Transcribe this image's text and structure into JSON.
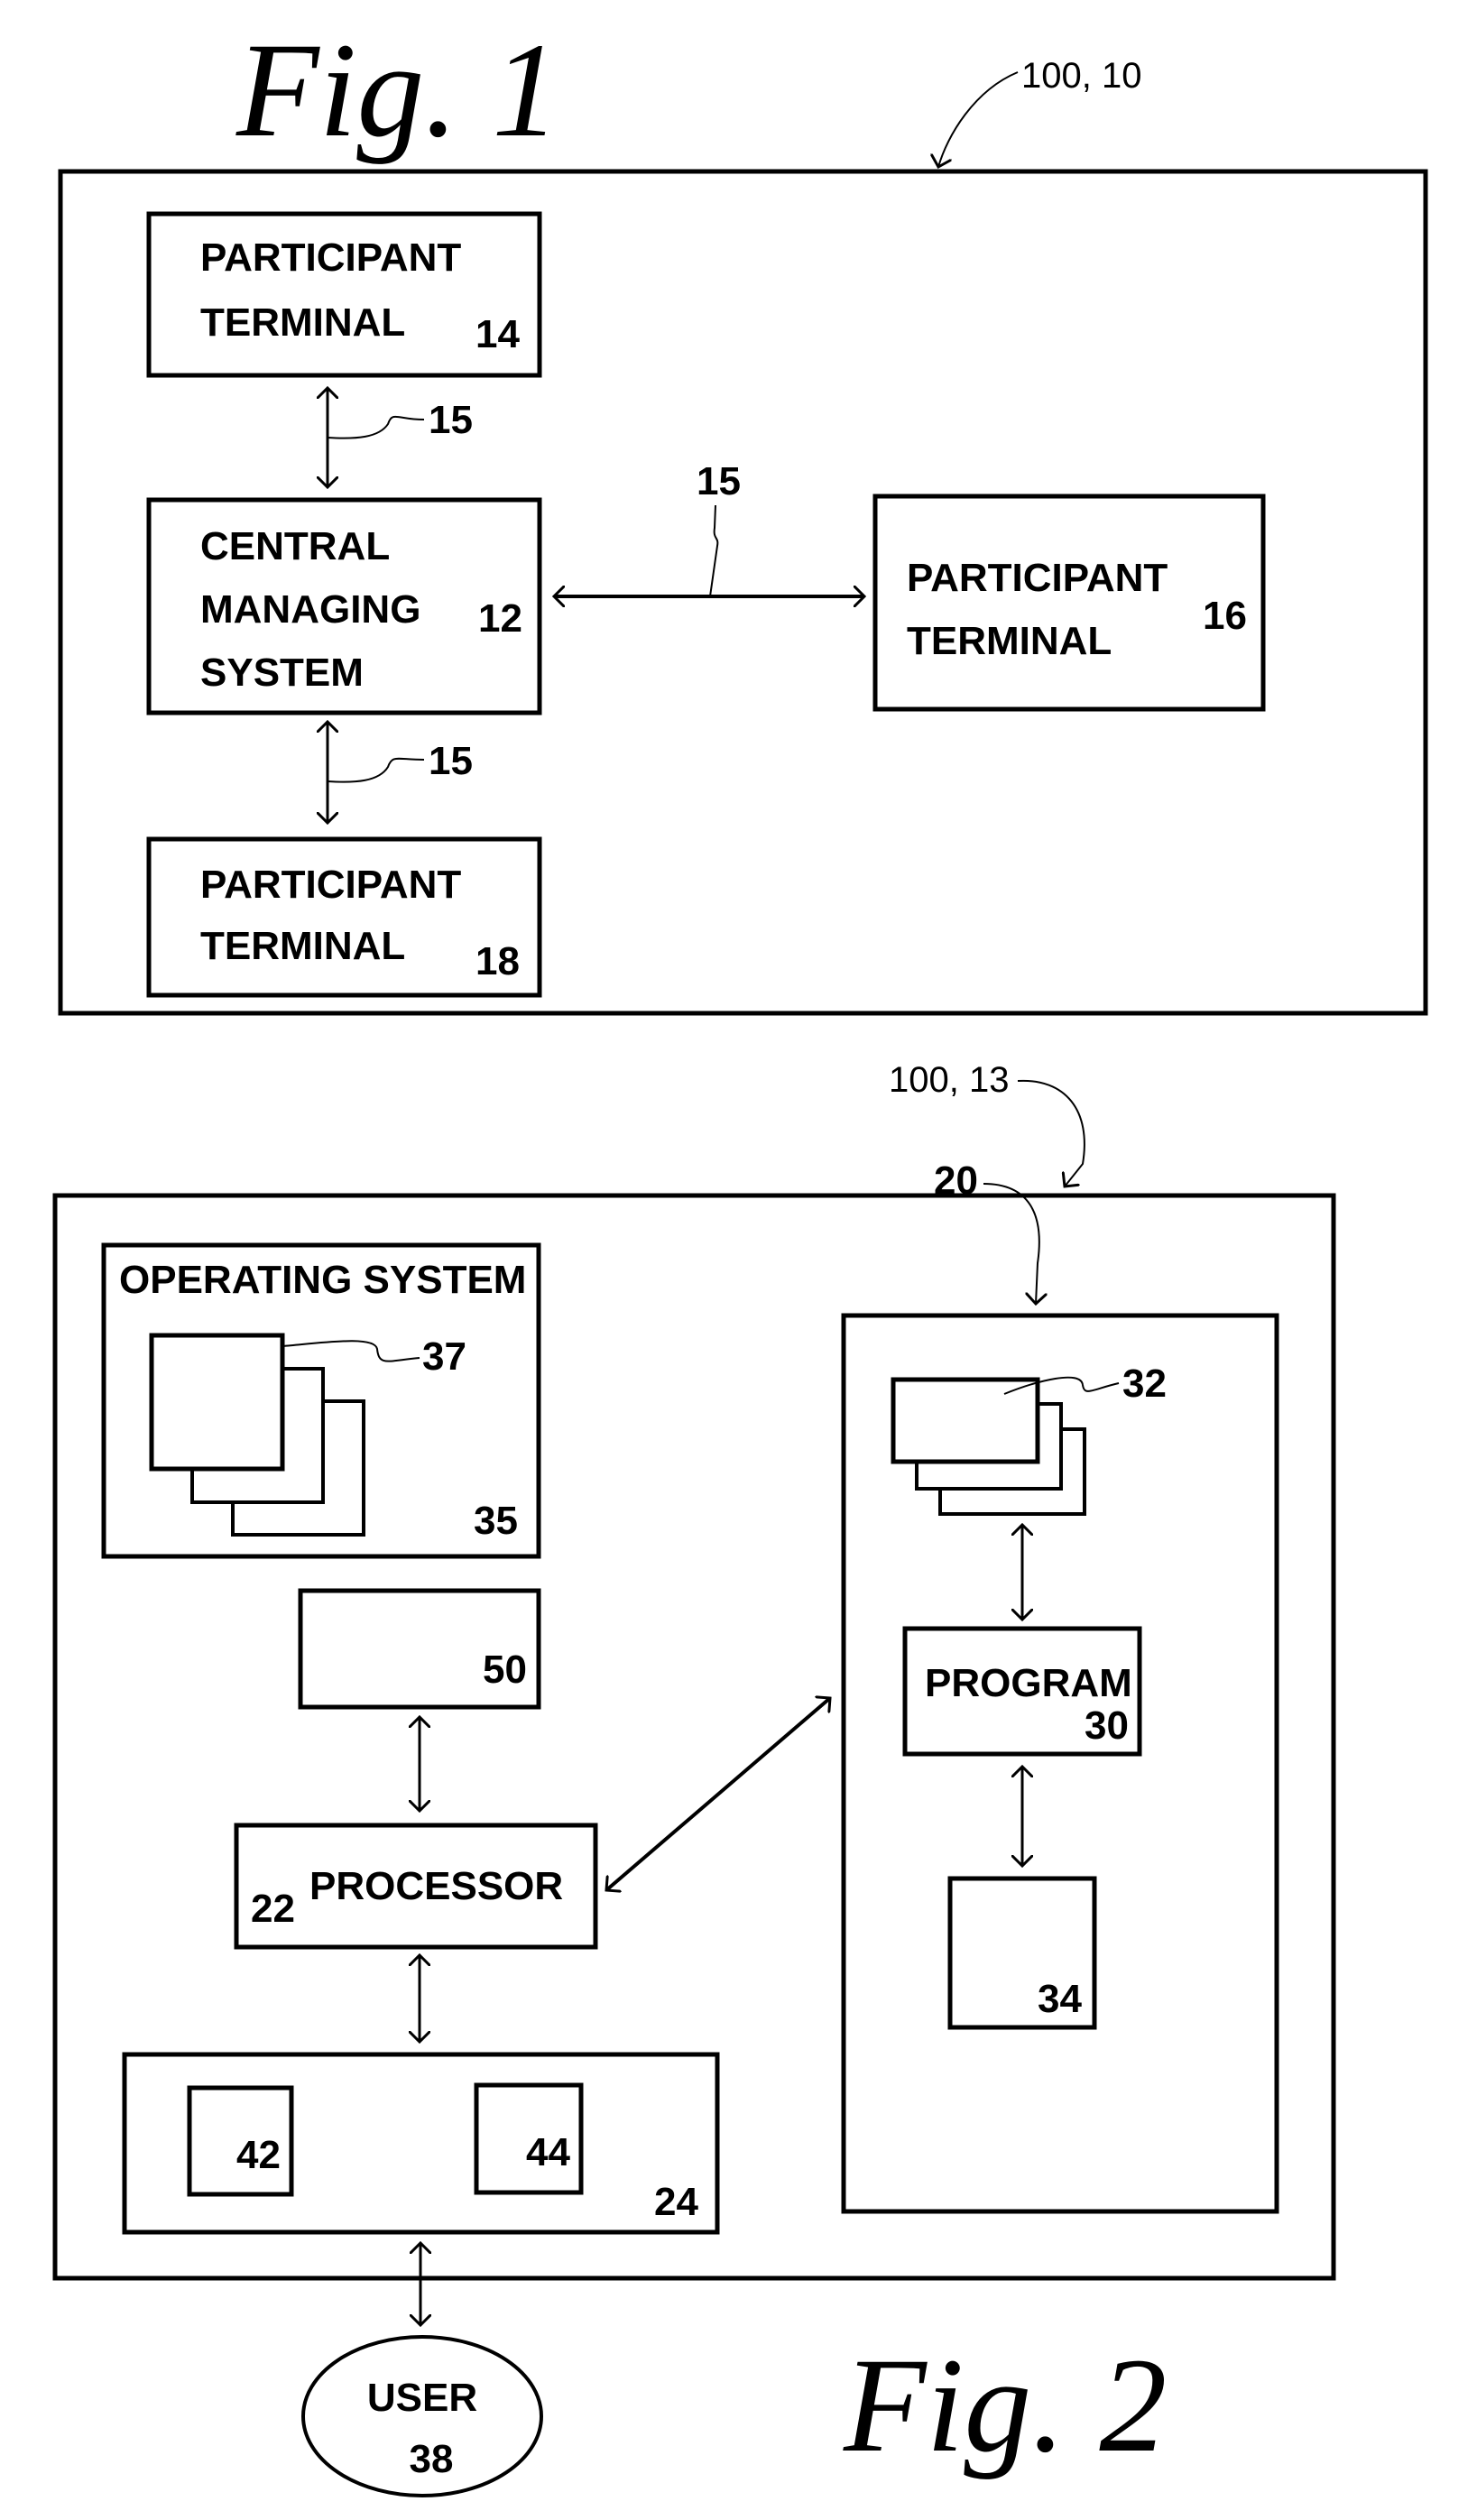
{
  "figure1": {
    "title": "Fig. 1",
    "ref_label": "100, 10",
    "connection_label": "15",
    "nodes": {
      "terminal_14": {
        "line1": "PARTICIPANT",
        "line2": "TERMINAL",
        "number": "14"
      },
      "central_12": {
        "line1": "CENTRAL",
        "line2": "MANAGING",
        "line3": "SYSTEM",
        "number": "12"
      },
      "terminal_16": {
        "line1": "PARTICIPANT",
        "line2": "TERMINAL",
        "number": "16"
      },
      "terminal_18": {
        "line1": "PARTICIPANT",
        "line2": "TERMINAL",
        "number": "18"
      }
    },
    "edges": [
      {
        "from": "14",
        "to": "12",
        "label": "15"
      },
      {
        "from": "12",
        "to": "16",
        "label": "15"
      },
      {
        "from": "12",
        "to": "18",
        "label": "15"
      }
    ]
  },
  "figure2": {
    "title": "Fig. 2",
    "ref_label": "100, 13",
    "nodes": {
      "os_35": {
        "label": "OPERATING SYSTEM",
        "number": "35",
        "docs_number": "37"
      },
      "box_50": {
        "number": "50"
      },
      "processor_22": {
        "label": "PROCESSOR",
        "number": "22"
      },
      "io_24": {
        "number": "24",
        "inner_left": "42",
        "inner_right": "44"
      },
      "group_20": {
        "number": "20",
        "docs_number": "32"
      },
      "program_30": {
        "label": "PROGRAM",
        "number": "30"
      },
      "box_34": {
        "number": "34"
      },
      "user_38": {
        "label": "USER",
        "number": "38"
      }
    },
    "edges": [
      {
        "from": "50",
        "to": "22"
      },
      {
        "from": "22",
        "to": "20"
      },
      {
        "from": "22",
        "to": "24"
      },
      {
        "from": "24",
        "to": "38"
      },
      {
        "from": "32",
        "to": "30"
      },
      {
        "from": "30",
        "to": "34"
      }
    ]
  }
}
